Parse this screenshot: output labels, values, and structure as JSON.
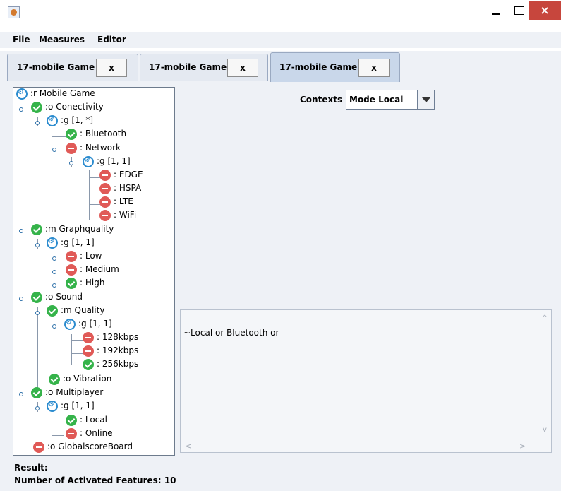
{
  "window": {
    "close_symbol": "×"
  },
  "menu": [
    "File",
    "Measures",
    "Editor"
  ],
  "tabs": [
    {
      "label": "17-mobile Game",
      "close_label": "x"
    },
    {
      "label": "17-mobile Game",
      "close_label": "x"
    },
    {
      "label": "17-mobile Game",
      "close_label": "x"
    }
  ],
  "tree": [
    {
      "label": ":r Mobile Game",
      "icon": "group-icon"
    },
    {
      "label": ":o Conectivity",
      "icon": "check-icon"
    },
    {
      "label": ":g [1, *]",
      "icon": "group-icon"
    },
    {
      "label": ": Bluetooth",
      "icon": "check-icon"
    },
    {
      "label": ": Network",
      "icon": "minus-icon"
    },
    {
      "label": ":g [1, 1]",
      "icon": "group-icon"
    },
    {
      "label": ": EDGE",
      "icon": "minus-icon"
    },
    {
      "label": ": HSPA",
      "icon": "minus-icon"
    },
    {
      "label": ": LTE",
      "icon": "minus-icon"
    },
    {
      "label": ": WiFi",
      "icon": "minus-icon"
    },
    {
      "label": ":m Graphquality",
      "icon": "check-icon"
    },
    {
      "label": ":g [1, 1]",
      "icon": "group-icon"
    },
    {
      "label": ": Low",
      "icon": "minus-icon"
    },
    {
      "label": ": Medium",
      "icon": "minus-icon"
    },
    {
      "label": ": High",
      "icon": "check-icon"
    },
    {
      "label": ":o Sound",
      "icon": "check-icon"
    },
    {
      "label": ":m Quality",
      "icon": "check-icon"
    },
    {
      "label": ":g [1, 1]",
      "icon": "group-icon"
    },
    {
      "label": ": 128kbps",
      "icon": "minus-icon"
    },
    {
      "label": ": 192kbps",
      "icon": "minus-icon"
    },
    {
      "label": ": 256kbps",
      "icon": "check-icon"
    },
    {
      "label": ":o Vibration",
      "icon": "check-icon"
    },
    {
      "label": ":o Multiplayer",
      "icon": "check-icon"
    },
    {
      "label": ":g [1, 1]",
      "icon": "group-icon"
    },
    {
      "label": ": Local",
      "icon": "check-icon"
    },
    {
      "label": ": Online",
      "icon": "minus-icon"
    },
    {
      "label": ":o GlobalscoreBoard",
      "icon": "minus-icon"
    }
  ],
  "contexts": {
    "label": "Contexts",
    "value": "Mode Local"
  },
  "expression": "~Local or Bluetooth or",
  "result": {
    "label": "Result:",
    "activated": "Number of Activated Features: 10"
  }
}
